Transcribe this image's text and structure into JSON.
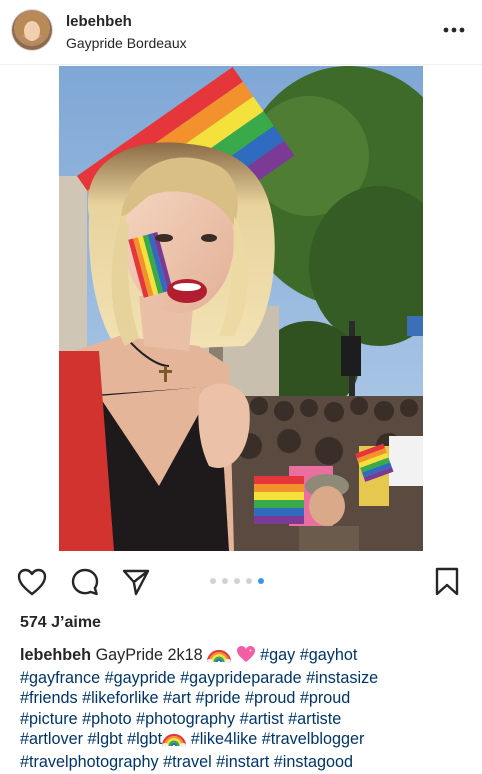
{
  "post": {
    "username": "lebehbeh",
    "location": "Gaypride Bordeaux",
    "more_label": "•••",
    "likes": "574 J’aime",
    "carousel": {
      "count": 5,
      "active": 4
    },
    "caption": {
      "user": "lebehbeh",
      "text_start": "GayPride 2k18",
      "tags_line1": "#gay #gayhot",
      "tags_line2": "#gayfrance #gaypride #gayprideparade #instasize",
      "tags_line3": "#friends #likeforlike #art #pride #proud #proud",
      "tags_line4": "#picture #photo #photography #artist #artiste",
      "tags_line5a": "#artlover #lgbt #lgbt",
      "tags_line5b": "#like4like #travelblogger",
      "tags_line6": "#travelphotography #travel #instart #instagood"
    }
  },
  "icons": {
    "like": "heart-icon",
    "comment": "comment-icon",
    "share": "send-icon",
    "save": "bookmark-icon",
    "rainbow": "rainbow-emoji",
    "heart_emoji": "pink-heart-emoji"
  },
  "colors": {
    "text": "#262626",
    "hashtag": "#003569",
    "dot_active": "#3897f0",
    "dot_inactive": "#d2d2d2"
  }
}
